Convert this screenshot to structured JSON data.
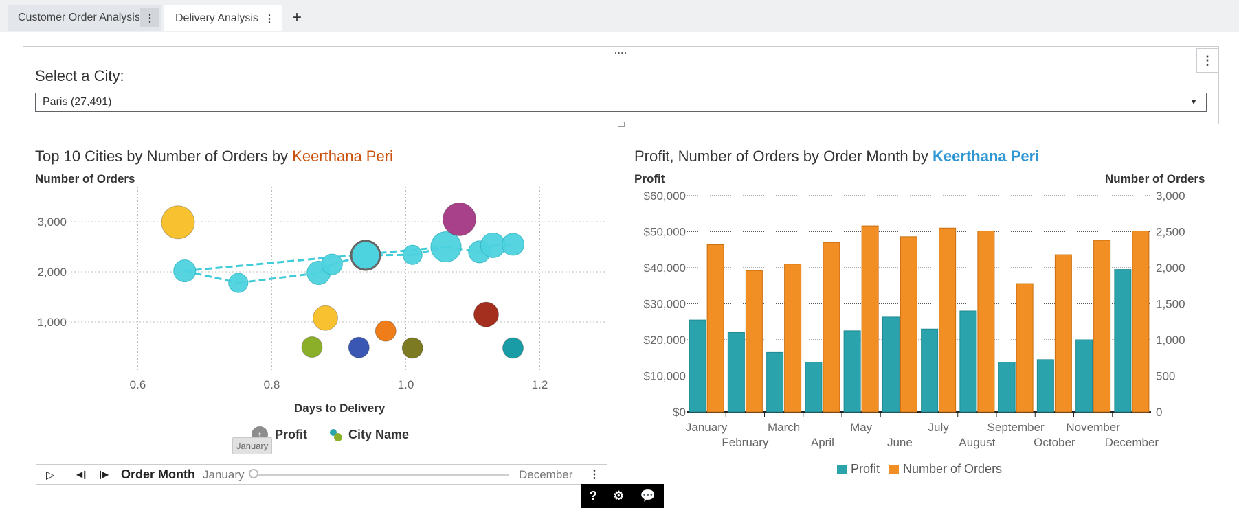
{
  "tabs": [
    {
      "label": "Customer Order Analysis"
    },
    {
      "label": "Delivery Analysis"
    }
  ],
  "icons": {
    "tab_more": "⋮",
    "add": "+",
    "panel_more": "⋮",
    "drag": "....",
    "caret": "▼",
    "play": "▷",
    "step_back": "◀❙",
    "step_fwd": "❙▶"
  },
  "controls": {
    "city_label": "Select a City:",
    "city_value": "Paris (27,491)"
  },
  "left_chart": {
    "title_prefix": "Top 10 Cities by Number of Orders by ",
    "author": "Keerthana Peri",
    "ylabel": "Number of Orders",
    "xlabel": "Days to Delivery",
    "legend_size": "Profit",
    "legend_color": "City Name",
    "tooltip": "January"
  },
  "animation": {
    "label": "Order Month",
    "start": "January",
    "end": "December"
  },
  "right_chart": {
    "title_prefix": "Profit, Number of Orders by Order Month by ",
    "author": "Keerthana Peri",
    "y_left_label": "Profit",
    "y_right_label": "Number of Orders",
    "legend": [
      {
        "label": "Profit",
        "color": "#2ba3ad"
      },
      {
        "label": "Number of Orders",
        "color": "#f18f24"
      }
    ]
  },
  "chart_data": [
    {
      "type": "scatter",
      "title": "Top 10 Cities by Number of Orders by Keerthana Peri",
      "xlabel": "Days to Delivery",
      "ylabel": "Number of Orders",
      "xlim": [
        0.5,
        1.3
      ],
      "ylim": [
        0,
        3700
      ],
      "xticks": [
        "0.6",
        "0.8",
        "1.0",
        "1.2"
      ],
      "yticks": [
        "1,000",
        "2,000",
        "3,000"
      ],
      "grid": true,
      "trail": [
        {
          "x": 0.67,
          "y": 2020
        },
        {
          "x": 0.75,
          "y": 1780
        },
        {
          "x": 0.87,
          "y": 1980
        },
        {
          "x": 0.89,
          "y": 2150
        },
        {
          "x": 0.94,
          "y": 2330
        },
        {
          "x": 1.01,
          "y": 2340
        },
        {
          "x": 1.06,
          "y": 2500
        },
        {
          "x": 1.11,
          "y": 2400
        },
        {
          "x": 1.13,
          "y": 2530
        },
        {
          "x": 1.16,
          "y": 2550
        }
      ],
      "points": [
        {
          "x": 0.66,
          "y": 2990,
          "size": 3,
          "color": "#f8c12f"
        },
        {
          "x": 1.08,
          "y": 3050,
          "size": 3,
          "color": "#a8408a"
        },
        {
          "x": 0.88,
          "y": 1080,
          "size": 2,
          "color": "#f8c12f"
        },
        {
          "x": 1.12,
          "y": 1150,
          "size": 2,
          "color": "#a52f1f"
        },
        {
          "x": 0.97,
          "y": 820,
          "size": 1.5,
          "color": "#ef7d1a"
        },
        {
          "x": 0.86,
          "y": 500,
          "size": 1.5,
          "color": "#8caf2a"
        },
        {
          "x": 0.93,
          "y": 490,
          "size": 1.5,
          "color": "#3a57b4"
        },
        {
          "x": 1.01,
          "y": 480,
          "size": 1.5,
          "color": "#7c7a22"
        },
        {
          "x": 1.16,
          "y": 480,
          "size": 1.5,
          "color": "#1a9ca6"
        }
      ]
    },
    {
      "type": "bar",
      "title": "Profit, Number of Orders by Order Month by Keerthana Peri",
      "categories": [
        "January",
        "February",
        "March",
        "April",
        "May",
        "June",
        "July",
        "August",
        "September",
        "October",
        "November",
        "December"
      ],
      "series": [
        {
          "name": "Profit",
          "axis": "left",
          "color": "#2ba3ad",
          "values": [
            25500,
            22000,
            16500,
            13800,
            22500,
            26300,
            23000,
            28000,
            13800,
            14500,
            20000,
            39500
          ]
        },
        {
          "name": "Number of Orders",
          "axis": "right",
          "color": "#f18f24",
          "values": [
            2320,
            1960,
            2050,
            2350,
            2580,
            2430,
            2550,
            2510,
            1780,
            2180,
            2380,
            2510
          ]
        }
      ],
      "y_left_ticks": [
        "$0",
        "$10,000",
        "$20,000",
        "$30,000",
        "$40,000",
        "$50,000",
        "$60,000"
      ],
      "y_right_ticks": [
        "0",
        "500",
        "1,000",
        "1,500",
        "2,000",
        "2,500",
        "3,000"
      ],
      "ylim_left": [
        0,
        60000
      ],
      "ylim_right": [
        0,
        3000
      ]
    }
  ],
  "help_bar": {
    "help": "?"
  }
}
